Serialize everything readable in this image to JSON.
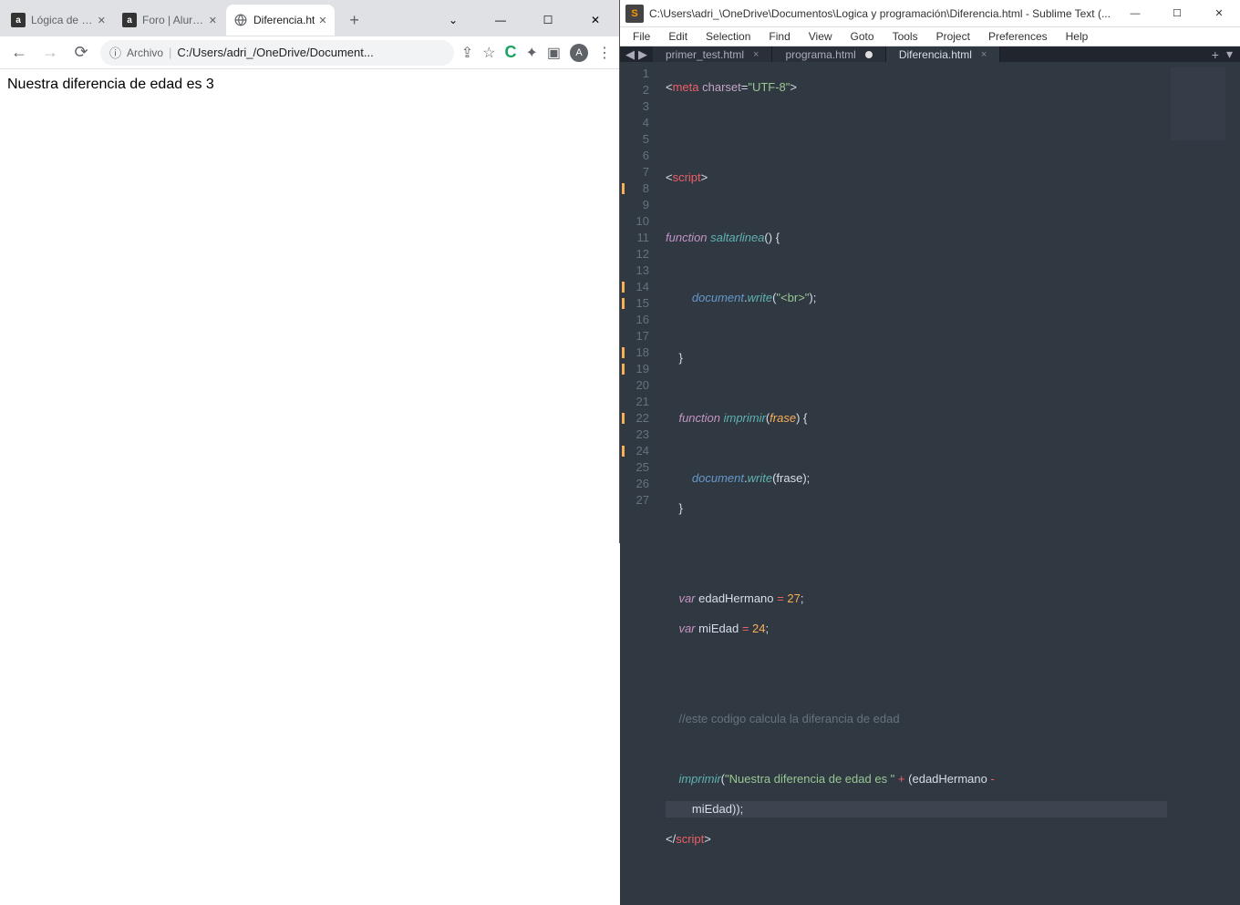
{
  "browser": {
    "tabs": [
      {
        "favicon": "a",
        "title": "Lógica de pro"
      },
      {
        "favicon": "a",
        "title": "Foro | Alura L"
      },
      {
        "favicon": "globe",
        "title": "Diferencia.ht",
        "active": true
      }
    ],
    "window_controls": {
      "down": "⌄",
      "min": "—",
      "max": "☐",
      "close": "✕"
    },
    "toolbar": {
      "back": "←",
      "forward": "→",
      "reload": "⟳",
      "info_icon": "ⓘ",
      "chip": "Archivo",
      "address": "C:/Users/adri_/OneDrive/Document...",
      "share": "⇪",
      "star": "☆",
      "ext_c": "C",
      "puzzle": "✦",
      "window": "▣",
      "avatar": "A",
      "menu": "⋮"
    },
    "page_text": "Nuestra diferencia de edad es 3"
  },
  "editor": {
    "titlebar": "C:\\Users\\adri_\\OneDrive\\Documentos\\Logica y programación\\Diferencia.html - Sublime Text (...",
    "window_controls": {
      "min": "—",
      "max": "☐",
      "close": "✕"
    },
    "menus": [
      "File",
      "Edit",
      "Selection",
      "Find",
      "View",
      "Goto",
      "Tools",
      "Project",
      "Preferences",
      "Help"
    ],
    "nav": {
      "left": "◀",
      "right": "▶"
    },
    "tabs": [
      {
        "label": "primer_test.html",
        "close": "×"
      },
      {
        "label": "programa.html",
        "dirty": true
      },
      {
        "label": "Diferencia.html",
        "close": "×",
        "active": true
      }
    ],
    "tabbar_right": {
      "plus": "+",
      "menu": "▾"
    },
    "line_numbers": [
      "1",
      "2",
      "3",
      "4",
      "5",
      "6",
      "7",
      "8",
      "9",
      "10",
      "11",
      "12",
      "13",
      "14",
      "15",
      "16",
      "17",
      "18",
      "19",
      "20",
      "21",
      "22",
      "23",
      "24",
      "25",
      "26",
      "27"
    ],
    "marked_lines": [
      8,
      14,
      15,
      18,
      19,
      22,
      24
    ],
    "code": {
      "l1": {
        "a": "<",
        "b": "meta",
        "c": " charset",
        "d": "=",
        "e": "\"UTF-8\"",
        "f": ">"
      },
      "l4": {
        "a": "<",
        "b": "script",
        "c": ">"
      },
      "l6": {
        "a": "function",
        "b": " saltarlinea",
        "c": "()",
        "d": " {"
      },
      "l8": {
        "a": "document",
        "b": ".",
        "c": "write",
        "d": "(",
        "e": "\"<br>\"",
        "f": ");"
      },
      "l10": {
        "a": "}"
      },
      "l12": {
        "a": "function",
        "b": " imprimir",
        "c": "(",
        "d": "frase",
        "e": ")",
        "f": " {"
      },
      "l14": {
        "a": "document",
        "b": ".",
        "c": "write",
        "d": "(",
        "e": "frase",
        "f": ");"
      },
      "l15": {
        "a": "}"
      },
      "l18": {
        "a": "var",
        "b": " edadHermano ",
        "c": "=",
        "d": " 27",
        "e": ";"
      },
      "l19": {
        "a": "var",
        "b": " miEdad ",
        "c": "=",
        "d": " 24",
        "e": ";"
      },
      "l22": {
        "a": "//este codigo calcula la diferancia de edad"
      },
      "l24": {
        "a": "imprimir",
        "b": "(",
        "c": "\"Nuestra diferencia de edad es \"",
        "d": " + ",
        "e": "(",
        "f": "edadHermano",
        "g": " - "
      },
      "l24b": {
        "a": "miEdad",
        "b": "));"
      },
      "l26": {
        "a": "</",
        "b": "script",
        "c": ">"
      }
    }
  }
}
